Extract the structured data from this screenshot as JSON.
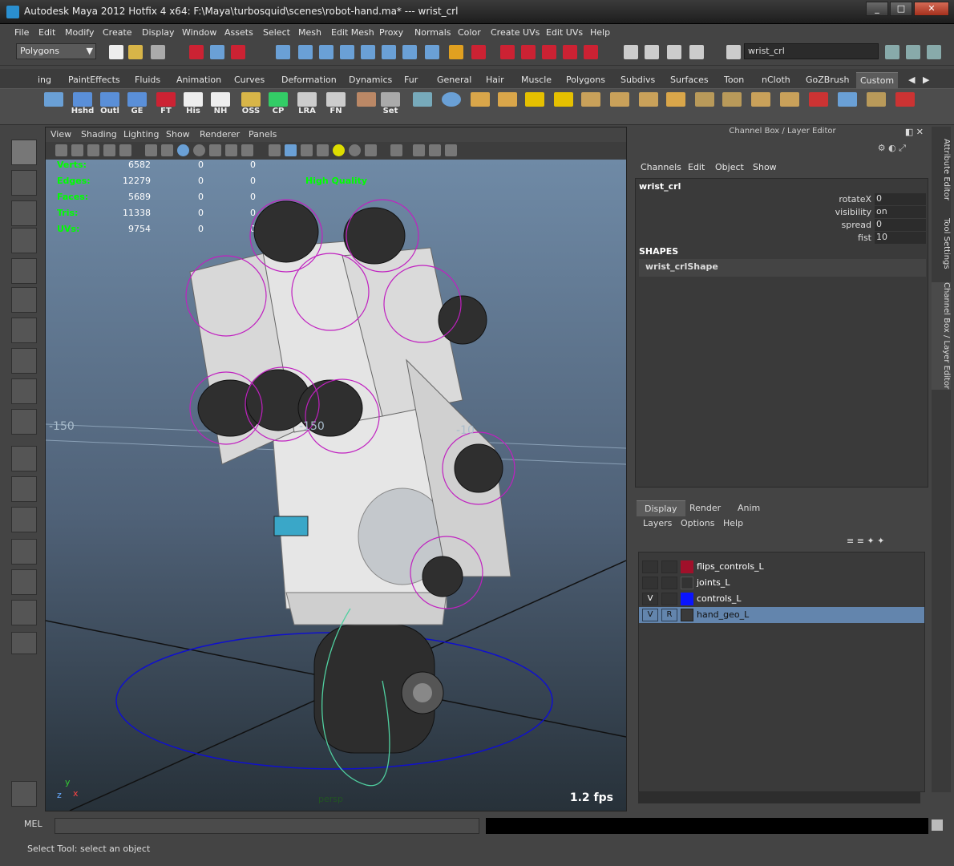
{
  "window": {
    "title": "Autodesk Maya 2012 Hotfix 4 x64: F:\\Maya\\turbosquid\\scenes\\robot-hand.ma*   ---   wrist_crl"
  },
  "menu": [
    "File",
    "Edit",
    "Modify",
    "Create",
    "Display",
    "Window",
    "Assets",
    "Select",
    "Mesh",
    "Edit Mesh",
    "Proxy",
    "Normals",
    "Color",
    "Create UVs",
    "Edit UVs",
    "Help"
  ],
  "statusline": {
    "mode": "Polygons",
    "name_field": "wrist_crl"
  },
  "shelf_tabs": [
    "ing",
    "PaintEffects",
    "Fluids",
    "Animation",
    "Curves",
    "Deformation",
    "Dynamics",
    "Fur",
    "General",
    "Hair",
    "Muscle",
    "Polygons",
    "Subdivs",
    "Surfaces",
    "Toon",
    "nCloth",
    "GoZBrush",
    "Custom"
  ],
  "shelf_buttons": [
    "Hshd",
    "Outl",
    "GE",
    "FT",
    "His",
    "NH",
    "OSS",
    "CP",
    "LRA",
    "FN",
    "Set"
  ],
  "viewport": {
    "menu": [
      "View",
      "Shading",
      "Lighting",
      "Show",
      "Renderer",
      "Panels"
    ],
    "hud": [
      {
        "label": "Verts:",
        "v1": "6582",
        "v2": "0",
        "v3": "0"
      },
      {
        "label": "Edges:",
        "v1": "12279",
        "v2": "0",
        "v3": "0"
      },
      {
        "label": "Faces:",
        "v1": "5689",
        "v2": "0",
        "v3": "0"
      },
      {
        "label": "Tris:",
        "v1": "11338",
        "v2": "0",
        "v3": "0"
      },
      {
        "label": "UVs:",
        "v1": "9754",
        "v2": "0",
        "v3": "0"
      }
    ],
    "quality": "High Quality",
    "grid_labels": [
      "-150",
      "-150",
      "-10"
    ],
    "fps": "1.2 fps",
    "camera": "persp",
    "axis_y": "y",
    "axis_z": "z",
    "axis_x": "x"
  },
  "channel_box": {
    "header": "Channel Box / Layer Editor",
    "menu": [
      "Channels",
      "Edit",
      "Object",
      "Show"
    ],
    "object": "wrist_crl",
    "attributes": [
      {
        "name": "rotateX",
        "value": "0"
      },
      {
        "name": "visibility",
        "value": "on"
      },
      {
        "name": "spread",
        "value": "0"
      },
      {
        "name": "fist",
        "value": "10"
      }
    ],
    "shapes_label": "SHAPES",
    "shape_name": "wrist_crlShape"
  },
  "side_tabs": [
    "Attribute Editor",
    "Tool Settings",
    "Channel Box / Layer Editor"
  ],
  "layer_editor": {
    "tabs": [
      "Display",
      "Render",
      "Anim"
    ],
    "menu": [
      "Layers",
      "Options",
      "Help"
    ],
    "layers": [
      {
        "v": "",
        "r": "",
        "color": "#a0102a",
        "name": "flips_controls_L",
        "selected": false
      },
      {
        "v": "",
        "r": "",
        "color": "#333333",
        "name": "joints_L",
        "selected": false
      },
      {
        "v": "V",
        "r": "",
        "color": "#0a14ff",
        "name": "controls_L",
        "selected": false
      },
      {
        "v": "V",
        "r": "R",
        "color": "#3a3a3a",
        "name": "hand_geo_L",
        "selected": true
      }
    ]
  },
  "command_line": {
    "label": "MEL"
  },
  "help_line": {
    "text": "Select Tool: select an object"
  }
}
